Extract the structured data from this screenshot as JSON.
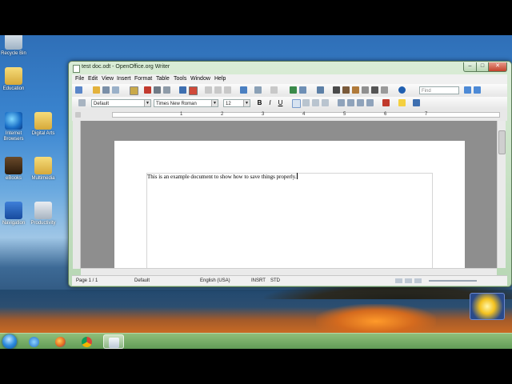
{
  "window": {
    "title": "test doc.odt - OpenOffice.org Writer",
    "controls": {
      "minimize": "–",
      "maximize": "□",
      "close": "✕"
    }
  },
  "menu": {
    "items": [
      "File",
      "Edit",
      "View",
      "Insert",
      "Format",
      "Table",
      "Tools",
      "Window",
      "Help"
    ]
  },
  "toolbar": {
    "paragraph_style": "Default",
    "font_name": "Times New Roman",
    "font_size": "12",
    "bold": "B",
    "italic": "I",
    "underline": "U",
    "find_placeholder": "Find"
  },
  "ruler": {
    "ticks": [
      "1",
      "2",
      "3",
      "4",
      "5",
      "6",
      "7"
    ]
  },
  "document": {
    "text": "This is an example document to show how to save things properly."
  },
  "statusbar": {
    "page": "Page 1 / 1",
    "page_style": "Default",
    "language": "English (USA)",
    "insert_mode": "INSRT",
    "selection_mode": "STD"
  },
  "desktop": {
    "icons": [
      "Recycle Bin",
      "Education",
      "Internet Browsers",
      "Digital Arts",
      "eBooks",
      "Multimedia",
      "Navigation",
      "Productivity"
    ]
  },
  "taskbar": {
    "apps": [
      "internet-explorer",
      "firefox",
      "chrome",
      "openoffice-writer"
    ],
    "active": "openoffice-writer"
  },
  "colors": {
    "window_frame": "#b7d7b4",
    "taskbar": "#6fa763",
    "page_background": "#8e8e8e"
  }
}
